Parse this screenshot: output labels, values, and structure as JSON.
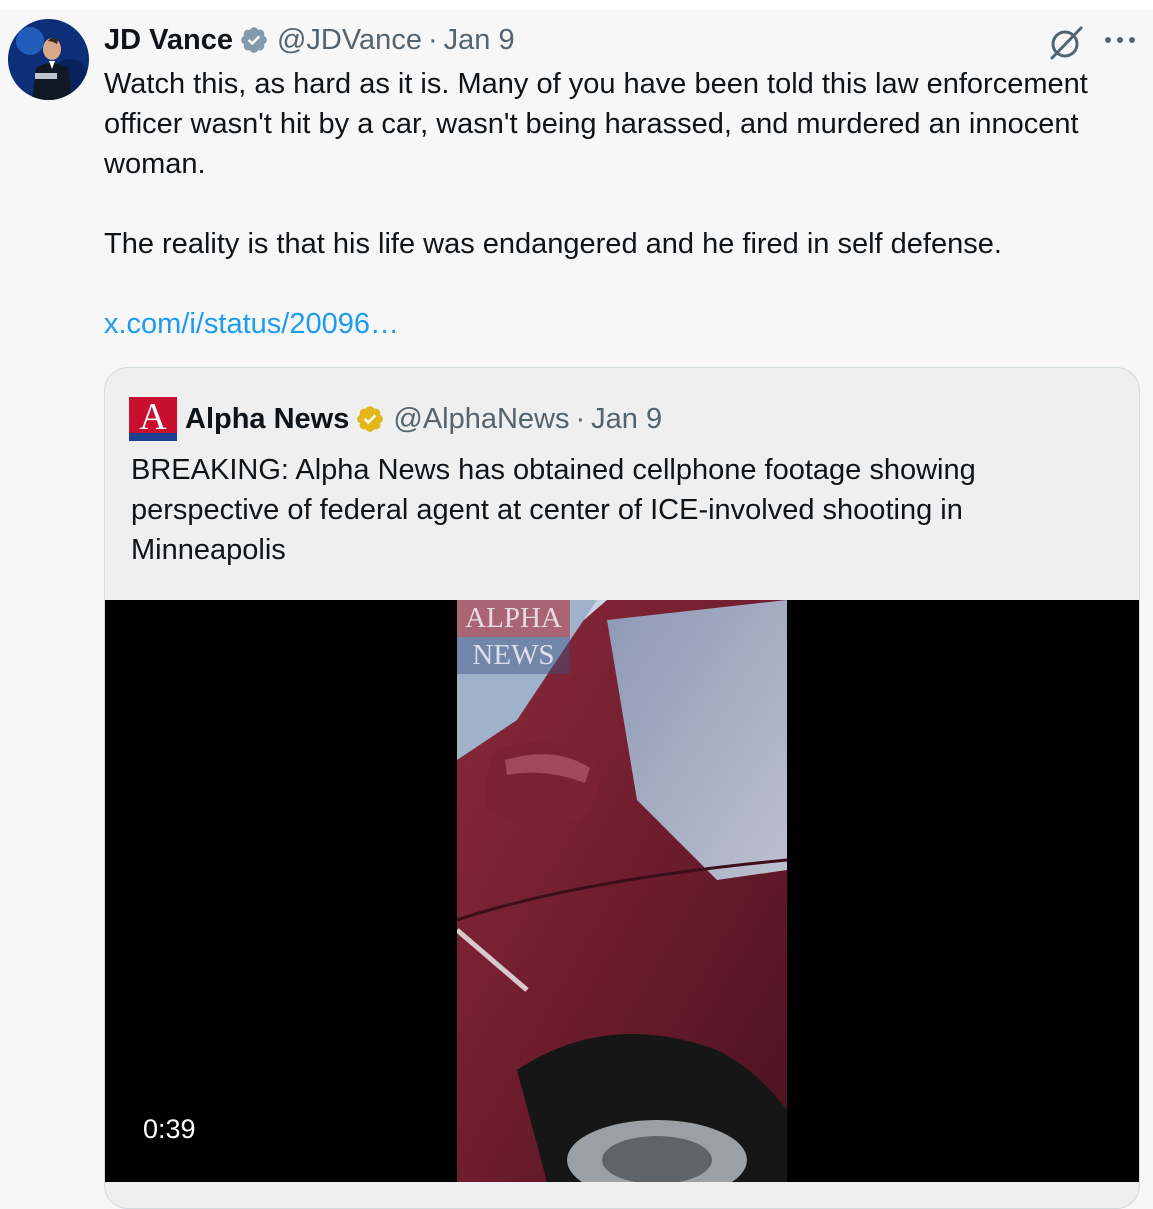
{
  "tweet": {
    "author_name": "JD Vance",
    "handle": "@JDVance",
    "separator": "·",
    "date": "Jan 9",
    "paragraphs": [
      "Watch this, as hard as it is. Many of you have been told this law enforcement officer wasn't hit by a car, wasn't being harassed, and murdered an innocent woman.",
      "The reality is that his life was endangered and he fired in self defense."
    ],
    "link": "x.com/i/status/20096…",
    "icons": {
      "avatar": "avatar",
      "verified": "verified-badge-icon",
      "grok": "grok-icon",
      "more": "more-icon"
    },
    "colors": {
      "verified": "#829aab",
      "link": "#1d9bf0",
      "secondary": "#536471"
    }
  },
  "quoted": {
    "author_name": "Alpha News",
    "handle": "@AlphaNews",
    "separator": "·",
    "date": "Jan 9",
    "text": "BREAKING: Alpha News has obtained cellphone footage showing perspective of federal agent at center of ICE-involved shooting in Minneapolis",
    "logo_letter": "A",
    "icons": {
      "logo": "alpha-news-logo",
      "verified": "gold-verified-badge-icon"
    },
    "colors": {
      "verified": "#e2b719",
      "logo": "#c8102e"
    },
    "video": {
      "duration": "0:39",
      "watermark": [
        "ALPHA",
        "NEWS"
      ]
    }
  }
}
